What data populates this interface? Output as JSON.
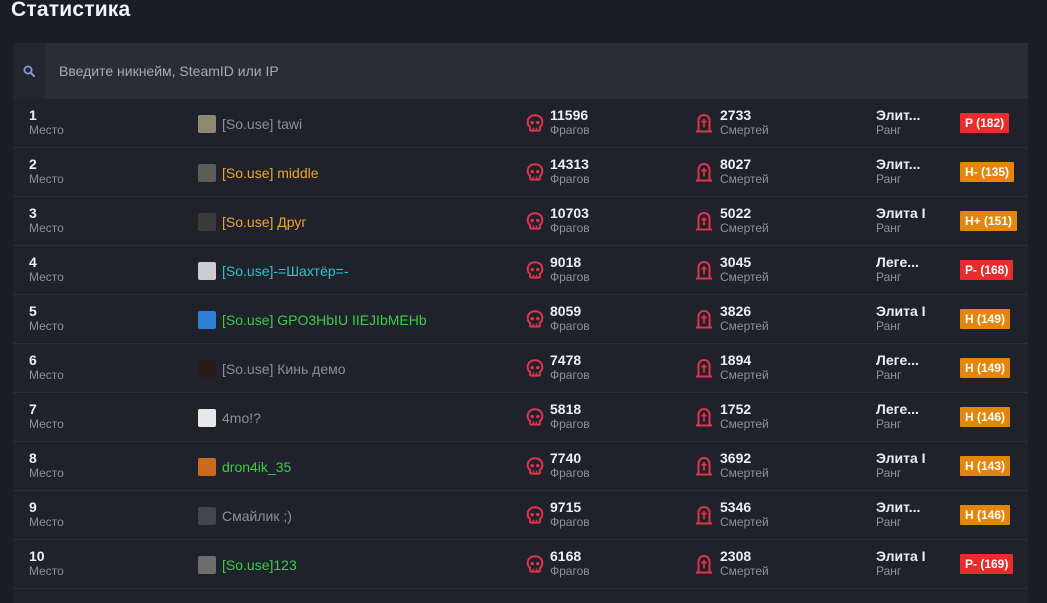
{
  "page": {
    "title": "Статистика"
  },
  "search": {
    "placeholder": "Введите никнейм, SteamID или IP",
    "value": ""
  },
  "labels": {
    "place": "Место",
    "kills": "Фрагов",
    "deaths": "Смертей",
    "level": "Ранг"
  },
  "colors": {
    "accent_red": "#e0334c",
    "badge_red": "#ea2b2b",
    "badge_orange": "#e4860c",
    "nick_gray": "#8b8f99",
    "nick_orange": "#f0a52c",
    "nick_cyan": "#2cc3d0",
    "nick_green": "#3dcc43"
  },
  "players": [
    {
      "rank": "1",
      "name": "[So.use] tawi",
      "name_color": "#8b8f99",
      "avatar_color": "#8e8a72",
      "kills": "11596",
      "deaths": "2733",
      "level": "Элит...",
      "rating": "P (182)",
      "rating_color": "#ea2b2b"
    },
    {
      "rank": "2",
      "name": "[So.use] middle",
      "name_color": "#f0a52c",
      "avatar_color": "#5b5e58",
      "kills": "14313",
      "deaths": "8027",
      "level": "Элит...",
      "rating": "H- (135)",
      "rating_color": "#e4860c"
    },
    {
      "rank": "3",
      "name": "[So.use] Друг",
      "name_color": "#f0a52c",
      "avatar_color": "#3a3a3a",
      "kills": "10703",
      "deaths": "5022",
      "level": "Элита I",
      "rating": "H+ (151)",
      "rating_color": "#e4860c"
    },
    {
      "rank": "4",
      "name": "[So.use]-=Шахтёр=-",
      "name_color": "#2cc3d0",
      "avatar_color": "#c9ccd1",
      "kills": "9018",
      "deaths": "3045",
      "level": "Леге...",
      "rating": "P- (168)",
      "rating_color": "#ea2b2b"
    },
    {
      "rank": "5",
      "name": "[So.use] GPO3HbIU IIEJIbMEHb",
      "name_color": "#3dcc43",
      "avatar_color": "#2f7fd6",
      "kills": "8059",
      "deaths": "3826",
      "level": "Элита I",
      "rating": "H (149)",
      "rating_color": "#e4860c"
    },
    {
      "rank": "6",
      "name": "[So.use] Кинь демо",
      "name_color": "#8b8f99",
      "avatar_color": "#2a1a1a",
      "kills": "7478",
      "deaths": "1894",
      "level": "Леге...",
      "rating": "H (149)",
      "rating_color": "#e4860c"
    },
    {
      "rank": "7",
      "name": "4mo!?",
      "name_color": "#8b8f99",
      "avatar_color": "#e8e8e8",
      "kills": "5818",
      "deaths": "1752",
      "level": "Леге...",
      "rating": "H (146)",
      "rating_color": "#e4860c"
    },
    {
      "rank": "8",
      "name": "dron4ik_35",
      "name_color": "#3dcc43",
      "avatar_color": "#c96a1c",
      "kills": "7740",
      "deaths": "3692",
      "level": "Элита I",
      "rating": "H (143)",
      "rating_color": "#e4860c"
    },
    {
      "rank": "9",
      "name": "Смайлик ;)",
      "name_color": "#8b8f99",
      "avatar_color": "#3f4650",
      "kills": "9715",
      "deaths": "5346",
      "level": "Элит...",
      "rating": "H (146)",
      "rating_color": "#e4860c"
    },
    {
      "rank": "10",
      "name": "[So.use]123",
      "name_color": "#3dcc43",
      "avatar_color": "#6d6d6d",
      "kills": "6168",
      "deaths": "2308",
      "level": "Элита I",
      "rating": "P- (169)",
      "rating_color": "#ea2b2b"
    }
  ]
}
